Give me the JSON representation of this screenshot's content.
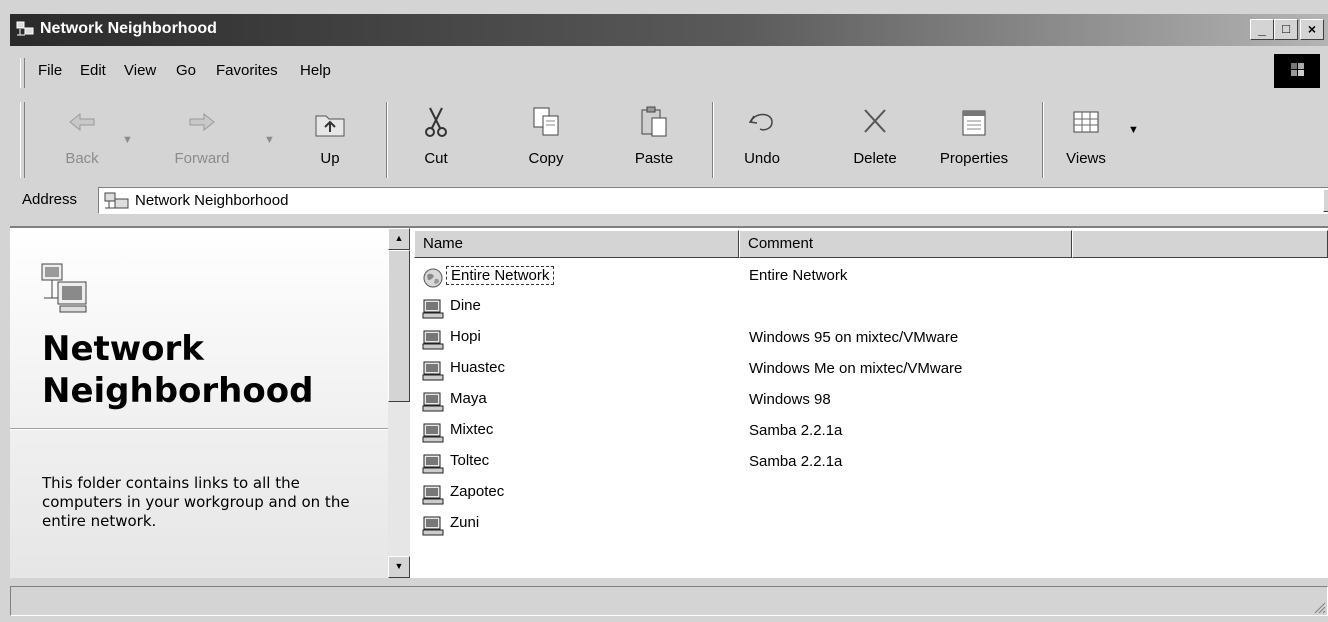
{
  "window": {
    "title": "Network Neighborhood",
    "controls": {
      "minimize": "_",
      "maximize": "□",
      "close": "×"
    }
  },
  "menu": [
    "File",
    "Edit",
    "View",
    "Go",
    "Favorites",
    "Help"
  ],
  "toolbar": {
    "back": "Back",
    "forward": "Forward",
    "up": "Up",
    "cut": "Cut",
    "copy": "Copy",
    "paste": "Paste",
    "undo": "Undo",
    "delete": "Delete",
    "properties": "Properties",
    "views": "Views"
  },
  "address": {
    "label": "Address",
    "value": "Network Neighborhood"
  },
  "webview": {
    "title": "Network Neighborhood",
    "description": "This folder contains links to all the computers in your workgroup and on the entire network."
  },
  "columns": [
    "Name",
    "Comment"
  ],
  "items": [
    {
      "name": "Entire Network",
      "comment": "Entire Network",
      "icon": "globe-icon"
    },
    {
      "name": "Dine",
      "comment": "",
      "icon": "computer-icon"
    },
    {
      "name": "Hopi",
      "comment": "Windows 95 on mixtec/VMware",
      "icon": "computer-icon"
    },
    {
      "name": "Huastec",
      "comment": "Windows Me on mixtec/VMware",
      "icon": "computer-icon"
    },
    {
      "name": "Maya",
      "comment": "Windows 98",
      "icon": "computer-icon"
    },
    {
      "name": "Mixtec",
      "comment": "Samba 2.2.1a",
      "icon": "computer-icon"
    },
    {
      "name": "Toltec",
      "comment": "Samba 2.2.1a",
      "icon": "computer-icon"
    },
    {
      "name": "Zapotec",
      "comment": "",
      "icon": "computer-icon"
    },
    {
      "name": "Zuni",
      "comment": "",
      "icon": "computer-icon"
    }
  ],
  "status": {
    "text": ""
  }
}
